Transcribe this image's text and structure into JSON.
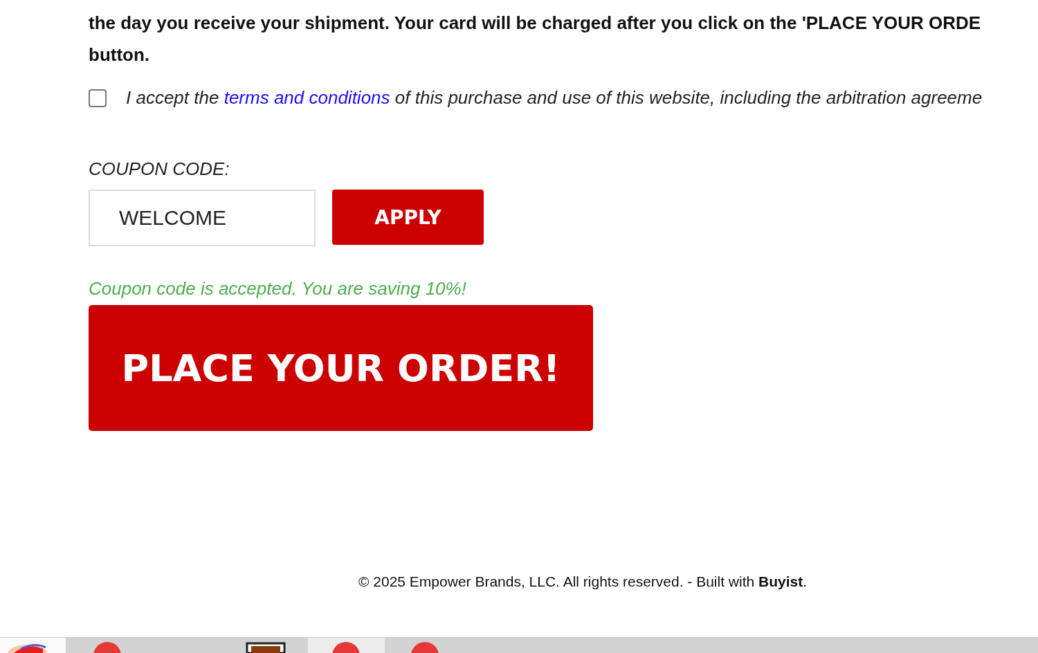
{
  "notice": {
    "lines": [
      "the day you receive your shipment. Your card will be charged after you click on the 'PLACE YOUR ORDE",
      "button."
    ]
  },
  "terms": {
    "checked": false,
    "before": "I accept the",
    "link": "terms and conditions",
    "after": "of this purchase and use of this website, including the arbitration agreeme"
  },
  "coupon": {
    "label": "COUPON CODE:",
    "value": "WELCOME",
    "button": "APPLY",
    "message": "Coupon code is accepted. You are saving 10%!"
  },
  "order_button": "PLACE YOUR ORDER!",
  "footer": "© 2025 Empower Brands, LLC. All rights reserved. - Built with **Buyist**."
}
